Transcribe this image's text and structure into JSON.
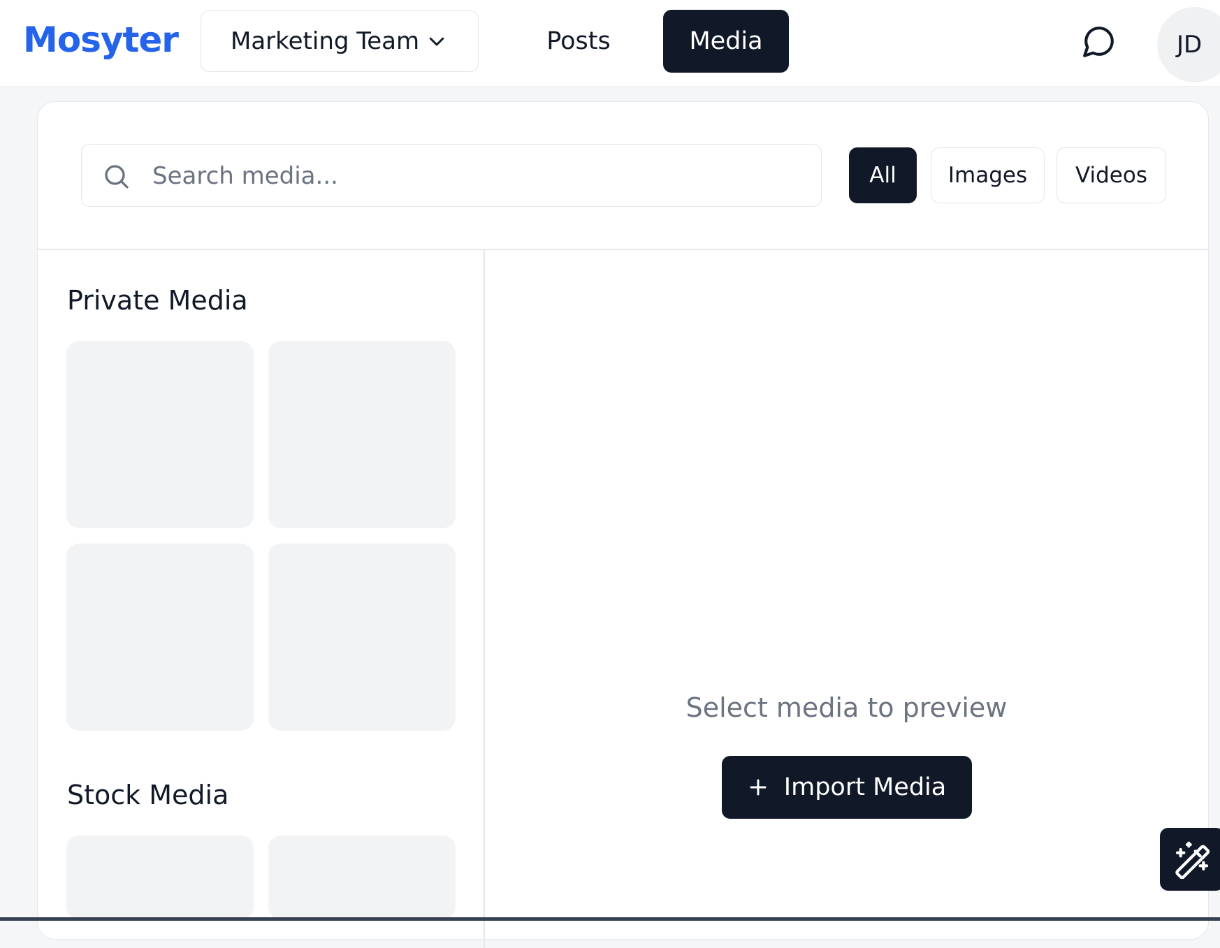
{
  "app": {
    "logo": "Mosyter"
  },
  "header": {
    "team_selector_label": "Marketing Team",
    "nav": {
      "posts": "Posts",
      "media": "Media"
    },
    "avatar_initials": "JD"
  },
  "media_library": {
    "search_placeholder": "Search media...",
    "filters": {
      "all": "All",
      "images": "Images",
      "videos": "Videos"
    },
    "active_filter": "All",
    "sections": {
      "private_title": "Private Media",
      "stock_title": "Stock Media"
    },
    "preview": {
      "empty_text": "Select media to preview",
      "import_button_label": "Import Media"
    }
  },
  "colors": {
    "brand": "#2563eb",
    "dark": "#111827",
    "muted_text": "#6b7280",
    "tile_placeholder": "#f2f3f5"
  },
  "icons": [
    "chevron-down-icon",
    "chat-bubble-icon",
    "search-icon",
    "plus-icon",
    "magic-wand-icon"
  ]
}
